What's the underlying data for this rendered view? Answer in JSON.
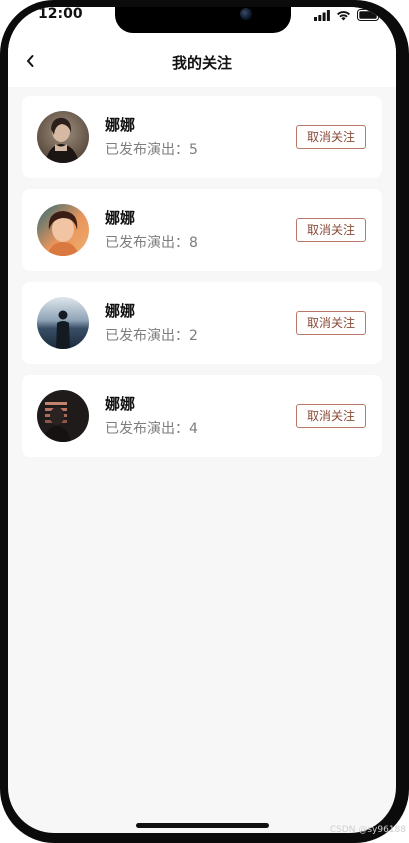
{
  "status_bar": {
    "time": "12:00"
  },
  "header": {
    "title": "我的关注",
    "back_icon": "chevron-left-icon"
  },
  "follows": [
    {
      "name": "娜娜",
      "label": "已发布演出：",
      "count": "5",
      "button": "取消关注"
    },
    {
      "name": "娜娜",
      "label": "已发布演出：",
      "count": "8",
      "button": "取消关注"
    },
    {
      "name": "娜娜",
      "label": "已发布演出：",
      "count": "2",
      "button": "取消关注"
    },
    {
      "name": "娜娜",
      "label": "已发布演出：",
      "count": "4",
      "button": "取消关注"
    }
  ],
  "watermark": "CSDN @sy96188",
  "colors": {
    "page_bg": "#f7f7f7",
    "card_bg": "#ffffff",
    "button_border": "#b87968",
    "button_text": "#8a4a37",
    "meta_text": "#7d7d7d"
  }
}
